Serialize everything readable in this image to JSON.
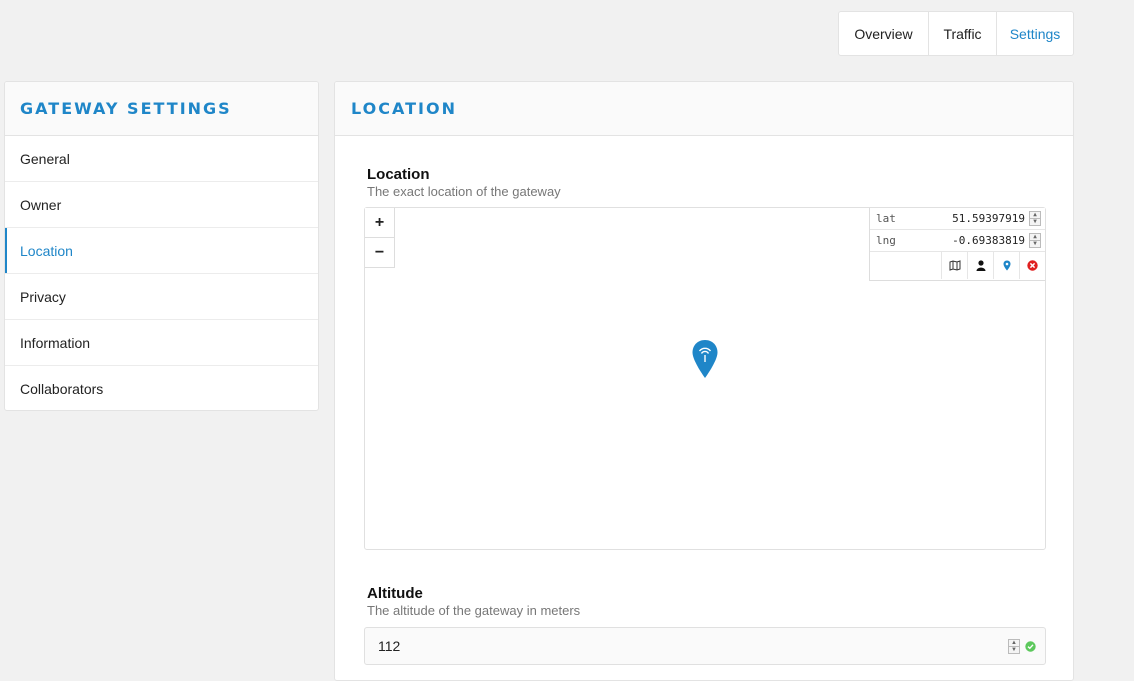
{
  "top_tabs": [
    {
      "label": "Overview",
      "active": false
    },
    {
      "label": "Traffic",
      "active": false
    },
    {
      "label": "Settings",
      "active": true
    }
  ],
  "sidebar": {
    "title": "GATEWAY SETTINGS",
    "items": [
      {
        "label": "General",
        "active": false
      },
      {
        "label": "Owner",
        "active": false
      },
      {
        "label": "Location",
        "active": true
      },
      {
        "label": "Privacy",
        "active": false
      },
      {
        "label": "Information",
        "active": false
      },
      {
        "label": "Collaborators",
        "active": false
      }
    ]
  },
  "main": {
    "title": "LOCATION",
    "location": {
      "label": "Location",
      "description": "The exact location of the gateway",
      "zoom_in": "+",
      "zoom_out": "−",
      "lat_label": "lat",
      "lat_value": "51.59397919",
      "lng_label": "lng",
      "lng_value": "-0.69383819",
      "tools": [
        "map-icon",
        "person-icon",
        "pin-icon",
        "clear-icon"
      ]
    },
    "altitude": {
      "label": "Altitude",
      "description": "The altitude of the gateway in meters",
      "value": "112"
    }
  },
  "colors": {
    "accent": "#1f86c8",
    "background": "#f1f1f1",
    "valid": "#5cc85c",
    "error": "#e02020"
  }
}
